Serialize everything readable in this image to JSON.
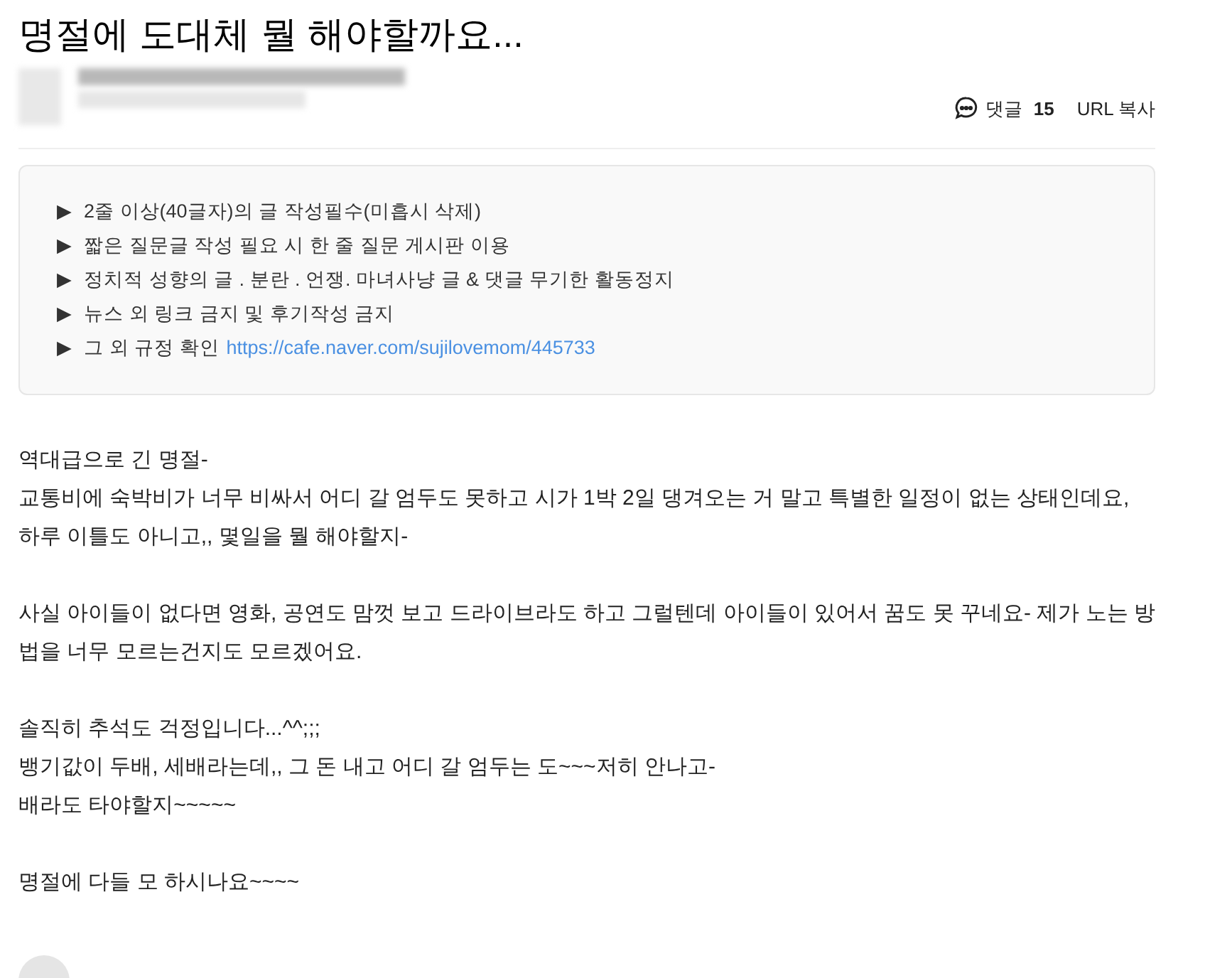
{
  "title": "명절에 도대체 뭘 해야할까요...",
  "comment_button": {
    "label": "댓글",
    "count": "15"
  },
  "url_copy": "URL 복사",
  "notice": [
    {
      "marker": "▶",
      "text": "2줄 이상(40글자)의 글 작성필수(미흡시 삭제)"
    },
    {
      "marker": "▶",
      "text": "짧은 질문글 작성 필요 시 한 줄 질문 게시판 이용"
    },
    {
      "marker": "▶",
      "text": "정치적 성향의 글 . 분란 . 언쟁. 마녀사냥 글 & 댓글 무기한 활동정지"
    },
    {
      "marker": "▶",
      "text": "뉴스 외 링크 금지 및 후기작성 금지"
    },
    {
      "marker": "▶",
      "text": "그 외 규정 확인",
      "link": "https://cafe.naver.com/sujilovemom/445733"
    }
  ],
  "body": [
    [
      "역대급으로 긴 명절-",
      "교통비에 숙박비가 너무 비싸서 어디 갈 엄두도 못하고 시가 1박 2일 댕겨오는 거 말고 특별한 일정이 없는 상태인데요, 하루 이틀도 아니고,, 몇일을 뭘 해야할지-"
    ],
    [
      "사실 아이들이 없다면 영화, 공연도 맘껏 보고 드라이브라도 하고 그럴텐데 아이들이 있어서 꿈도 못 꾸네요- 제가 노는 방법을 너무 모르는건지도 모르겠어요."
    ],
    [
      "솔직히 추석도 걱정입니다...^^;;;",
      "뱅기값이 두배, 세배라는데,, 그 돈 내고 어디 갈 엄두는 도~~~저히 안나고-",
      "배라도 타야할지~~~~~"
    ],
    [
      "명절에 다들 모 하시나요~~~~"
    ]
  ]
}
